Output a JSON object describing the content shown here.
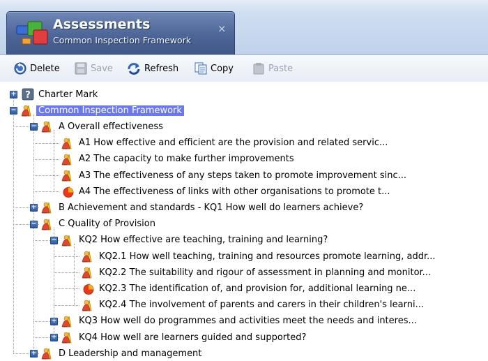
{
  "window": {
    "tab_title": "Assessments",
    "tab_subtitle": "Common Inspection Framework",
    "close_glyph": "×"
  },
  "toolbar": {
    "delete": "Delete",
    "save": "Save",
    "refresh": "Refresh",
    "copy": "Copy",
    "paste": "Paste"
  },
  "tree": [
    {
      "label": "Charter Mark",
      "icon": "question-icon",
      "expander": "+"
    },
    {
      "label": "Common Inspection Framework",
      "icon": "assessment-icon",
      "expander": "−",
      "selected": true
    },
    {
      "label": "A Overall effectiveness",
      "icon": "assessment-icon",
      "expander": "−"
    },
    {
      "label": "A1 How effective and efficient are the provision and related servic...",
      "icon": "assessment-icon"
    },
    {
      "label": "A2 The capacity to make further improvements",
      "icon": "assessment-icon"
    },
    {
      "label": "A3 The effectiveness of any steps taken to promote improvement sinc...",
      "icon": "assessment-icon"
    },
    {
      "label": "A4 The effectiveness of links with other organisations to promote t...",
      "icon": "alert-assessment-icon"
    },
    {
      "label": "B Achievement and standards - KQ1 How well do learners achieve?",
      "icon": "assessment-icon",
      "expander": "+"
    },
    {
      "label": "C Quality of Provision",
      "icon": "assessment-icon",
      "expander": "−"
    },
    {
      "label": "KQ2 How effective are teaching, training and learning?",
      "icon": "assessment-icon",
      "expander": "−"
    },
    {
      "label": "KQ2.1 How well teaching, training and resources promote learning, addr...",
      "icon": "assessment-icon"
    },
    {
      "label": "KQ2.2 The suitability and rigour of assessment in planning and monitor...",
      "icon": "assessment-icon"
    },
    {
      "label": "KQ2.3 The identification of, and provision for, additional learning ne...",
      "icon": "alert-assessment-icon"
    },
    {
      "label": "KQ2.4 The involvement of parents and carers in their children's learni...",
      "icon": "assessment-icon"
    },
    {
      "label": "KQ3 How well do programmes and activities meet the needs and interes...",
      "icon": "assessment-icon",
      "expander": "+"
    },
    {
      "label": "KQ4 How well are learners guided and supported?",
      "icon": "assessment-icon",
      "expander": "+"
    },
    {
      "label": "D Leadership and management",
      "icon": "assessment-icon",
      "expander": "+"
    }
  ]
}
